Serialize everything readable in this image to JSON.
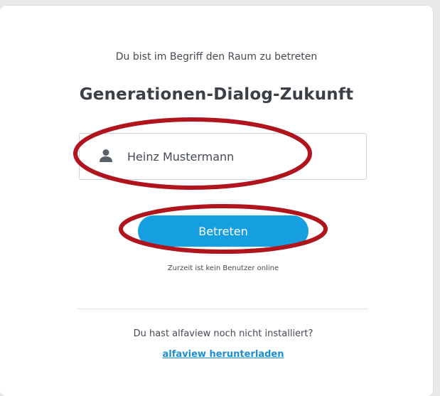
{
  "dialog": {
    "intro_text": "Du bist im Begriff den Raum zu betreten",
    "room_name": "Generationen-Dialog-Zukunft",
    "name_field": {
      "value": "Heinz Mustermann",
      "icon": "user-icon"
    },
    "enter_button_label": "Betreten",
    "online_status": "Zurzeit ist kein Benutzer online",
    "not_installed_text": "Du hast alfaview noch nicht installiert?",
    "download_link_label": "alfaview herunterladen"
  },
  "colors": {
    "accent": "#159fe0",
    "link": "#1b8ed3",
    "annotation": "#b0141c"
  }
}
